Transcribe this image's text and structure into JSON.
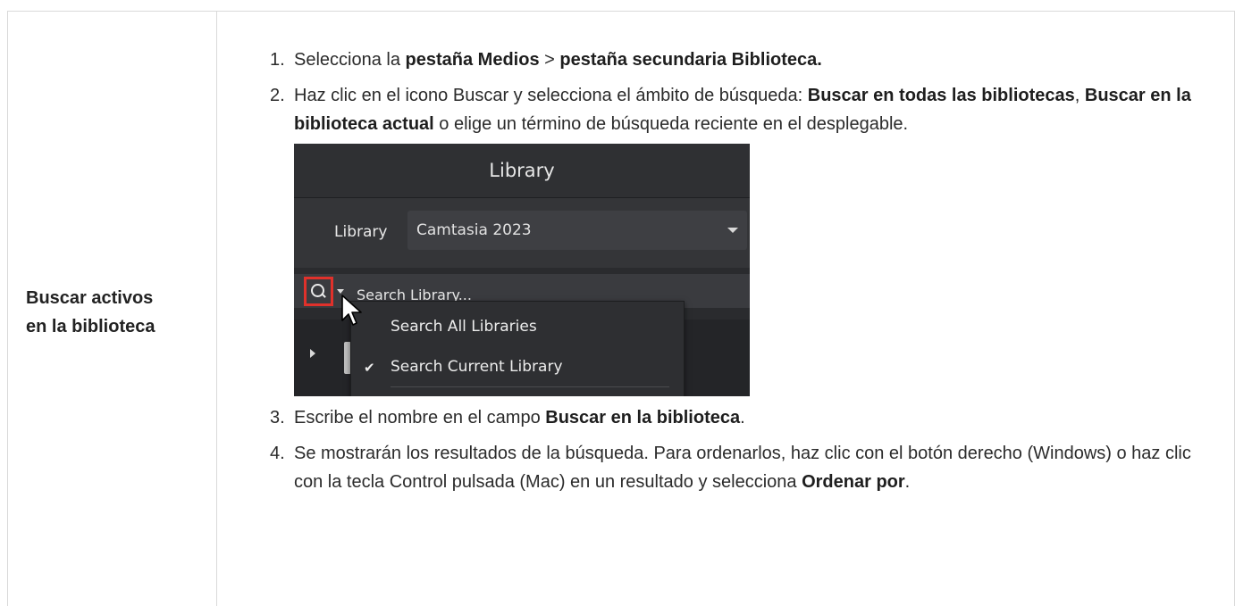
{
  "row": {
    "label_line1": "Buscar activos",
    "label_line2": "en la biblioteca"
  },
  "steps": [
    {
      "num": "1.",
      "parts": [
        "Selecciona la ",
        "pestaña Medios",
        " > ",
        "pestaña secundaria Biblioteca."
      ]
    },
    {
      "num": "2.",
      "parts": [
        "Haz clic en el icono Buscar y selecciona el ámbito de búsqueda: ",
        "Buscar en todas las bibliotecas",
        ", ",
        "Buscar en la biblioteca actual",
        " o elige un término de búsqueda reciente en el desplegable."
      ]
    },
    {
      "num": "3.",
      "parts": [
        "Escribe el nombre en el campo ",
        "Buscar en la biblioteca",
        "."
      ]
    },
    {
      "num": "4.",
      "parts": [
        "Se mostrarán los resultados de la búsqueda. Para ordenarlos, haz clic con el botón derecho (Windows) o haz clic con la tecla Control pulsada (Mac) en un resultado y selecciona ",
        "Ordenar por",
        "."
      ]
    }
  ],
  "screenshot": {
    "panel_title": "Library",
    "library_label": "Library",
    "library_value": "Camtasia 2023",
    "search_placeholder": "Search Library...",
    "menu_items": [
      "Search All Libraries",
      "Search Current Library"
    ],
    "highlight_color": "#e0312b"
  }
}
